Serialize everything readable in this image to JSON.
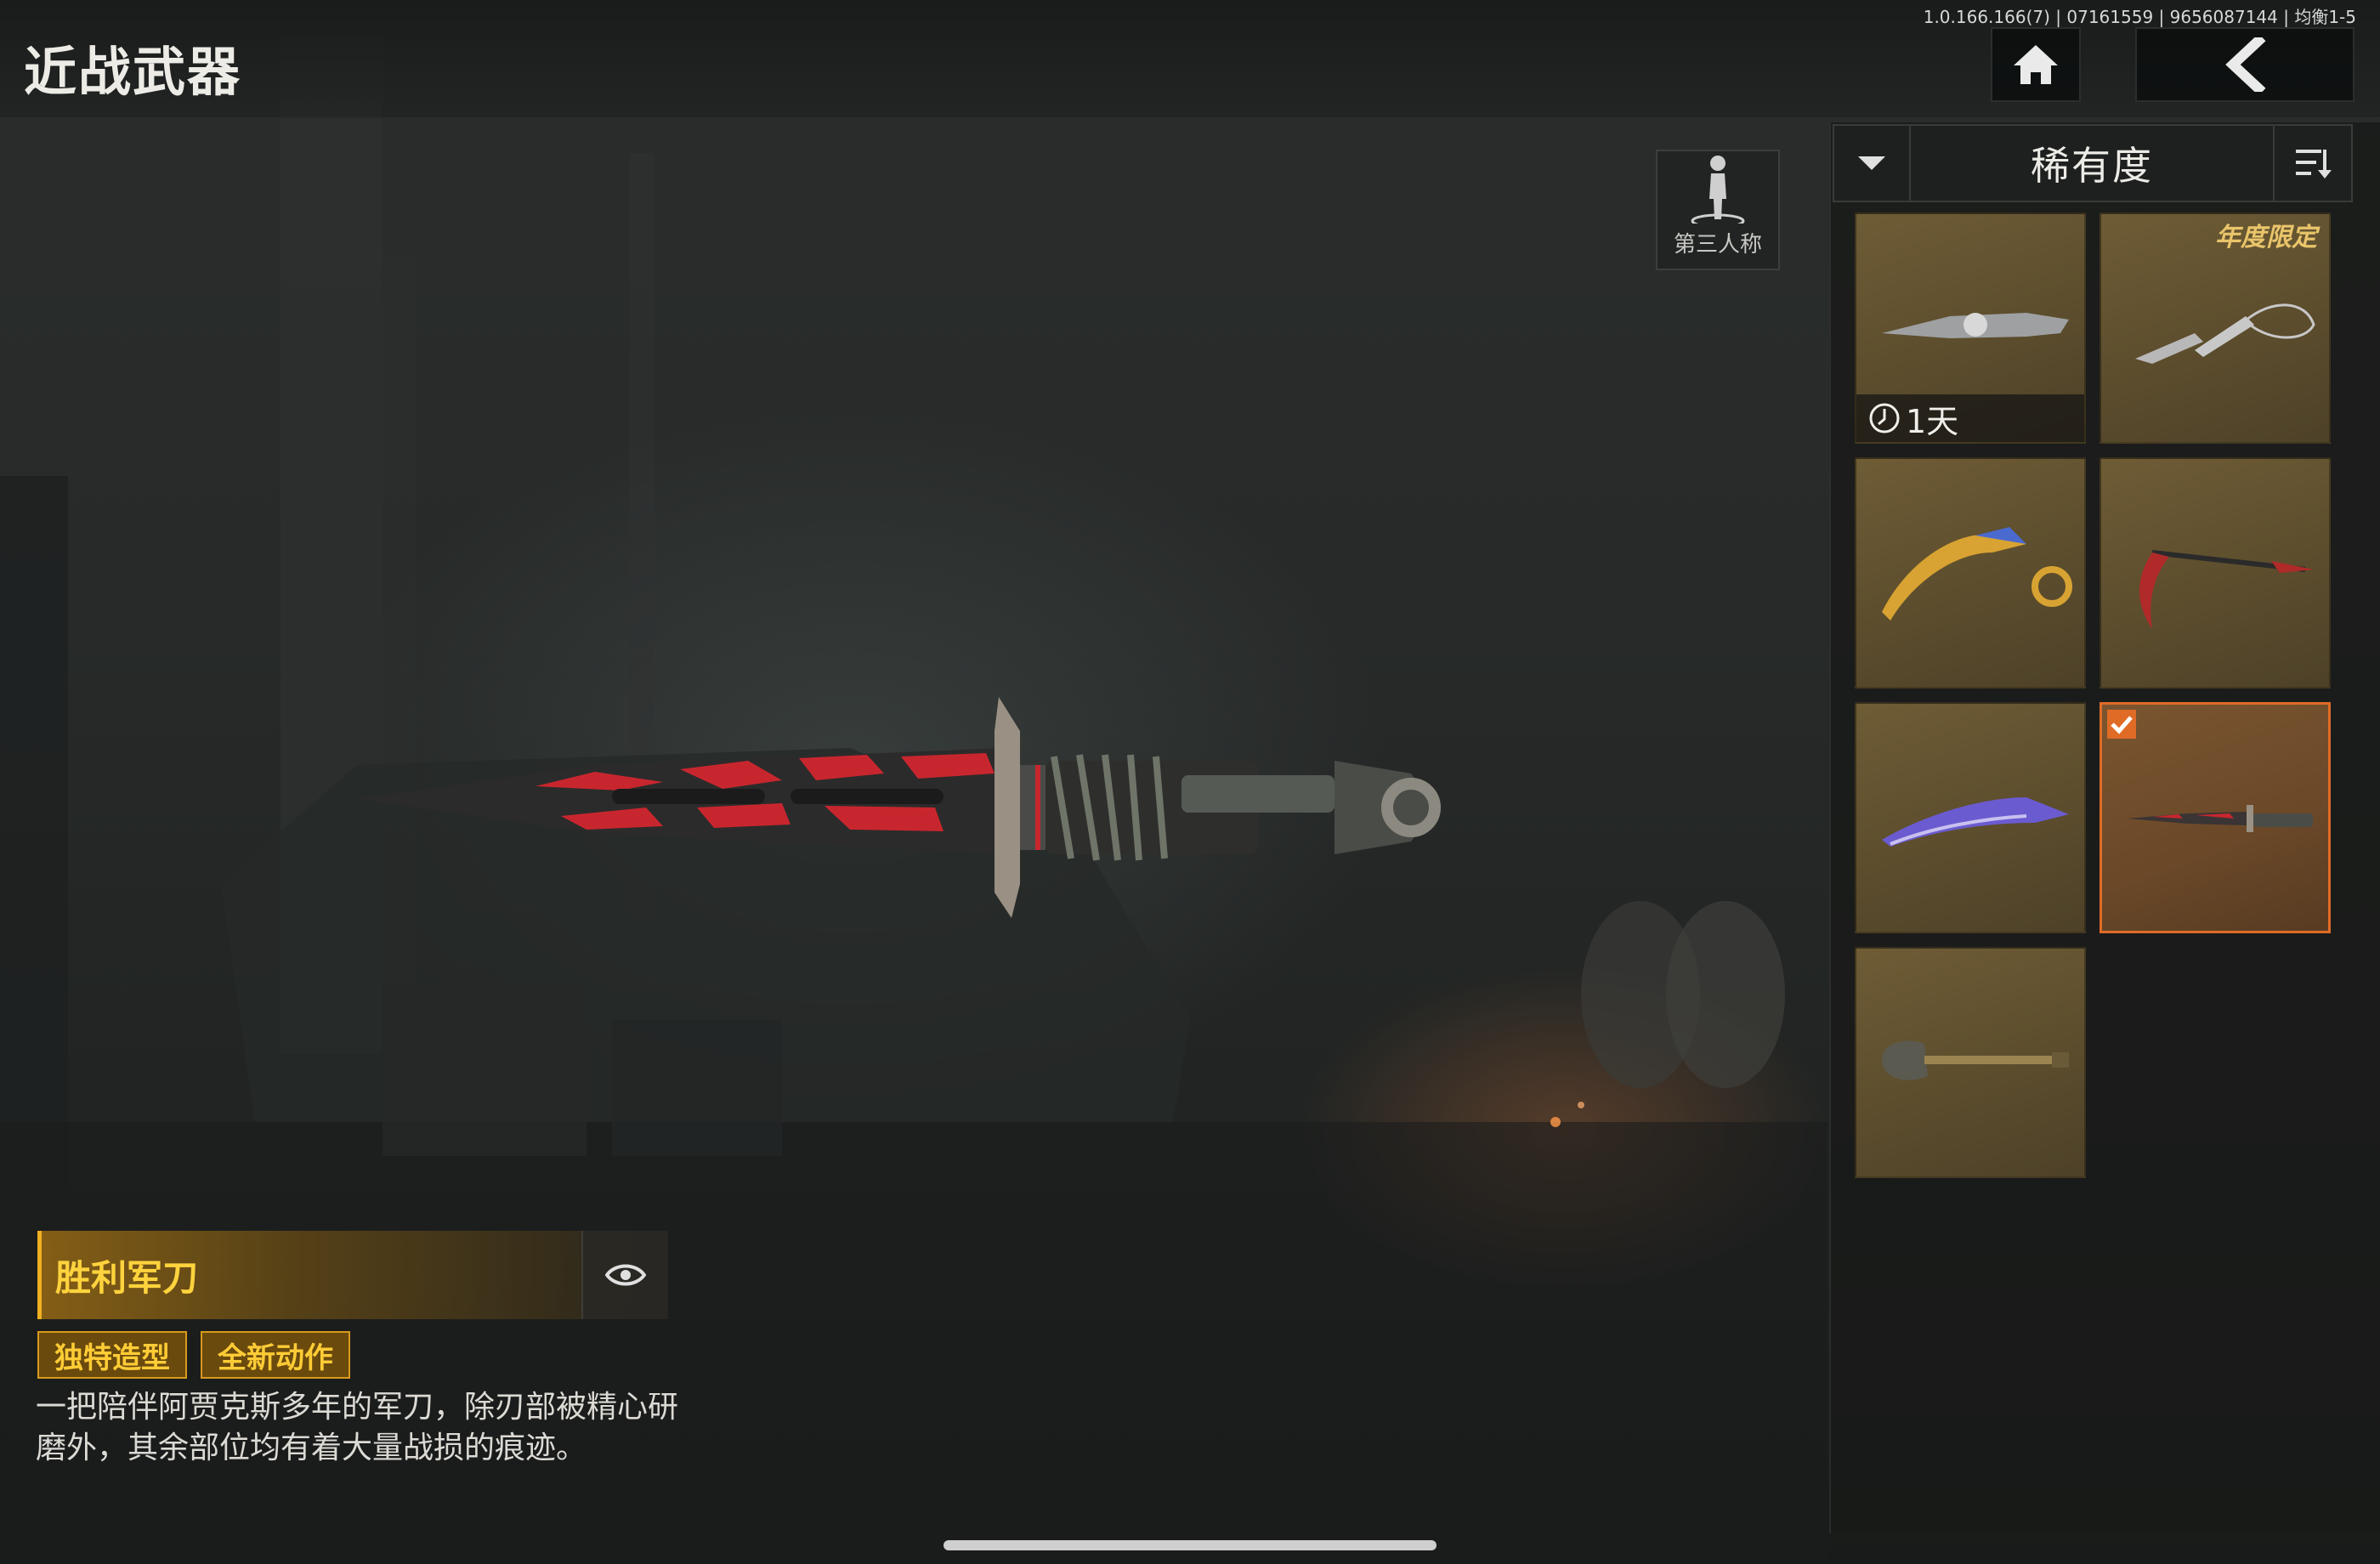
{
  "header": {
    "title": "近战武器",
    "version": "1.0.166.166(7) | 07161559 | 9656087144 | 均衡1-5"
  },
  "view_mode": {
    "label": "第三人称"
  },
  "sort": {
    "label": "稀有度"
  },
  "grid": {
    "items": [
      {
        "icon": "combat-knife-icon",
        "timer": "1天"
      },
      {
        "icon": "chain-blades-icon",
        "badge": "年度限定"
      },
      {
        "icon": "karambit-gold-icon"
      },
      {
        "icon": "scythe-icon"
      },
      {
        "icon": "purple-kukri-icon"
      },
      {
        "icon": "victory-combat-knife-icon",
        "selected": true
      },
      {
        "icon": "shovel-icon"
      }
    ]
  },
  "weapon": {
    "name": "胜利军刀",
    "tags": [
      "独特造型",
      "全新动作"
    ],
    "description": "一把陪伴阿贾克斯多年的军刀，除刃部被精心研磨外，其余部位均有着大量战损的痕迹。"
  },
  "colors": {
    "accent_orange": "#e06b26",
    "gold": "#ffd33d",
    "tile_bg": "#5c4d2d"
  }
}
